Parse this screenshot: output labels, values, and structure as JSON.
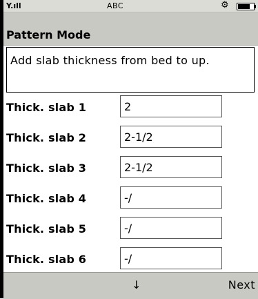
{
  "status_bar": {
    "signal_icon": "signal-strength-icon",
    "signal_glyph": "Y.ıll",
    "text": "ABC",
    "settings_icon": "gear-icon",
    "battery_icon": "battery-icon",
    "battery_level": 0.75
  },
  "title": "Pattern Mode",
  "description": "Add slab thickness from bed to up.",
  "fields": [
    {
      "label": "Thick. slab 1",
      "value": "2"
    },
    {
      "label": "Thick. slab 2",
      "value": "2-1/2"
    },
    {
      "label": "Thick. slab 3",
      "value": "2-1/2"
    },
    {
      "label": "Thick. slab 4",
      "value": "-/"
    },
    {
      "label": "Thick. slab 5",
      "value": "-/"
    },
    {
      "label": "Thick. slab 6",
      "value": "-/"
    }
  ],
  "softkeys": {
    "center_icon": "arrow-down-icon",
    "center_glyph": "↓",
    "right_label": "Next"
  }
}
